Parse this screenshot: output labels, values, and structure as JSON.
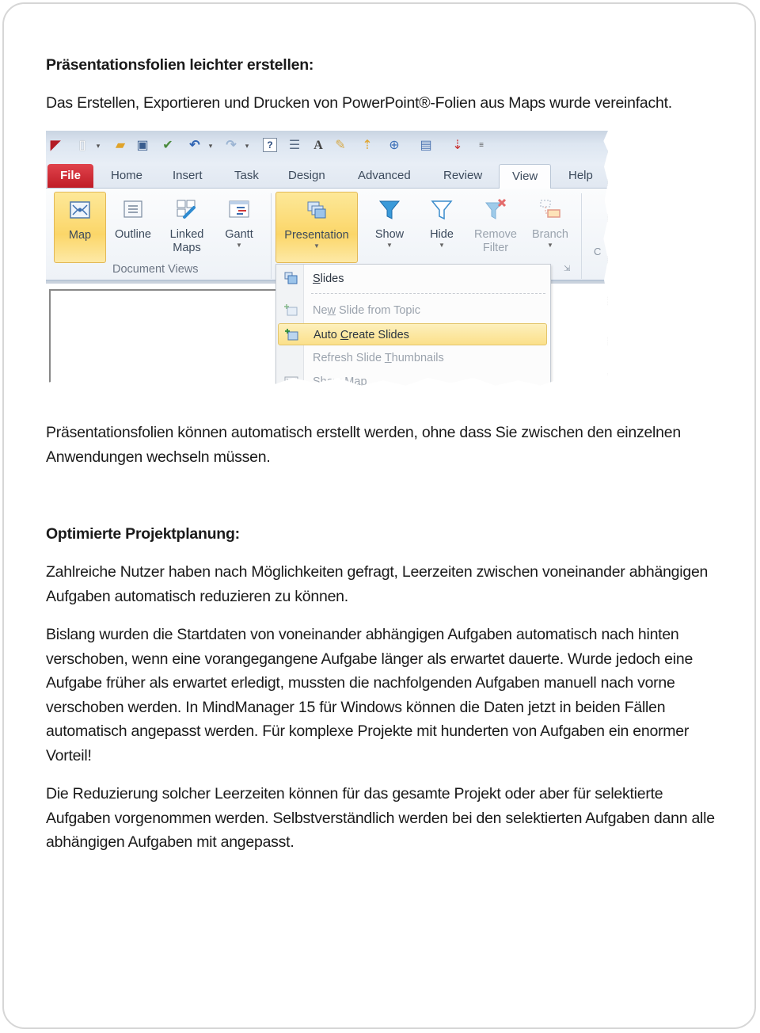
{
  "section1": {
    "heading": "Präsentationsfolien leichter erstellen:",
    "intro": "Das Erstellen, Exportieren und Drucken von PowerPoint®-Folien aus Maps wurde vereinfacht.",
    "body": "Präsentationsfolien können automatisch erstellt werden, ohne dass Sie zwischen den einzelnen Anwendungen wechseln müssen."
  },
  "screenshot": {
    "quick_access_icons": [
      "app-logo-icon",
      "new-document-icon",
      "open-folder-icon",
      "save-icon",
      "print-icon",
      "undo-icon",
      "redo-icon",
      "help-icon",
      "layout-icon",
      "font-icon",
      "format-painter-icon",
      "topic-icon",
      "add-icon",
      "map-theme-icon",
      "relationship-icon",
      "customize-qat-icon"
    ],
    "tabs": [
      "File",
      "Home",
      "Insert",
      "Task",
      "Design",
      "Advanced",
      "Review",
      "View",
      "Help"
    ],
    "active_tab": "View",
    "groups": [
      {
        "label": "Document Views",
        "buttons": [
          {
            "label": "Map",
            "icon": "map-view-icon",
            "state": "selected"
          },
          {
            "label": "Outline",
            "icon": "outline-icon",
            "state": "normal"
          },
          {
            "label": "Linked Maps",
            "icon": "linked-maps-icon",
            "state": "normal"
          },
          {
            "label": "Gantt",
            "icon": "gantt-icon",
            "state": "normal",
            "dropdown": true
          }
        ]
      },
      {
        "label": "",
        "buttons": [
          {
            "label": "Presentation",
            "icon": "presentation-icon",
            "state": "open",
            "dropdown": true
          },
          {
            "label": "Show",
            "icon": "filter-show-icon",
            "state": "normal",
            "dropdown": true
          },
          {
            "label": "Hide",
            "icon": "filter-hide-icon",
            "state": "normal",
            "dropdown": true
          },
          {
            "label": "Remove Filter",
            "icon": "remove-filter-icon",
            "state": "disabled"
          },
          {
            "label": "Branch",
            "icon": "branch-icon",
            "state": "disabled",
            "dropdown": true
          }
        ]
      }
    ],
    "menu": {
      "items": [
        {
          "label": "Slides",
          "accel": "S",
          "state": "normal",
          "icon": "slides-icon"
        },
        {
          "label": "New Slide from Topic",
          "accel": "w",
          "state": "disabled",
          "icon": "new-slide-icon"
        },
        {
          "label": "Auto Create Slides",
          "accel": "C",
          "state": "hover",
          "icon": "auto-create-slides-icon"
        },
        {
          "label": "Refresh Slide Thumbnails",
          "accel": "T",
          "state": "disabled",
          "icon": ""
        },
        {
          "label": "Show Map",
          "accel": "",
          "state": "disabled",
          "icon": "show-map-icon"
        }
      ]
    }
  },
  "section2": {
    "heading": "Optimierte Projektplanung:",
    "paragraphs": [
      "Zahlreiche Nutzer haben nach Möglichkeiten gefragt, Leerzeiten zwischen voneinander abhängigen Aufgaben automatisch reduzieren zu können.",
      "Bislang wurden die Startdaten von voneinander abhängigen Aufgaben automatisch nach hinten verschoben, wenn eine vorangegangene Aufgabe länger als erwartet dauerte. Wurde jedoch eine Aufgabe früher als erwartet erledigt, mussten die nachfolgenden Aufgaben manuell nach vorne verschoben werden. In MindManager 15 für Windows können die Daten jetzt in beiden Fällen automatisch angepasst werden. Für komplexe Projekte mit hunderten von Aufgaben ein enormer Vorteil!",
      "Die Reduzierung solcher Leerzeiten können für das gesamte Projekt oder aber für selektierte Aufgaben vorgenommen werden. Selbstverständlich werden bei den selektierten Aufgaben dann alle abhängigen Aufgaben mit angepasst."
    ]
  },
  "colors": {
    "file_tab": "#c8202b",
    "highlight": "#fbd669",
    "text": "#1a1a1a",
    "frame_border": "#d6d6d6"
  }
}
